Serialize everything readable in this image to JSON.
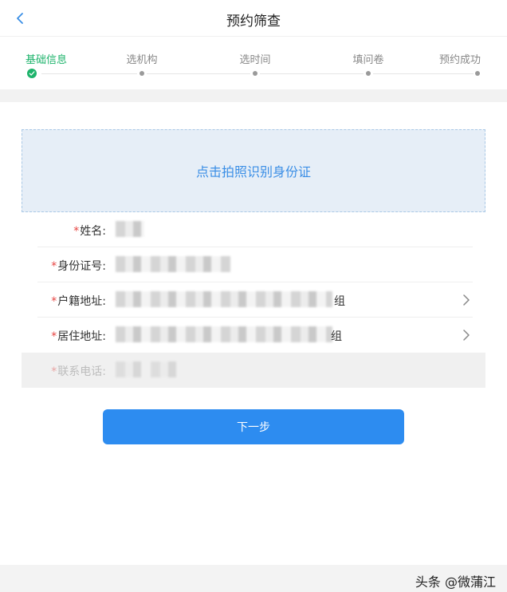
{
  "header": {
    "title": "预约筛查"
  },
  "steps": [
    {
      "label": "基础信息",
      "active": true
    },
    {
      "label": "选机构",
      "active": false
    },
    {
      "label": "选时间",
      "active": false
    },
    {
      "label": "填问卷",
      "active": false
    },
    {
      "label": "预约成功",
      "active": false
    }
  ],
  "photo": {
    "label": "点击拍照识别身份证"
  },
  "form": {
    "name_label": "姓名:",
    "idcard_label": "身份证号:",
    "hukou_label": "户籍地址:",
    "hukou_value_tail": "组",
    "residence_label": "居住地址:",
    "residence_value_tail": "组",
    "phone_label": "联系电话:"
  },
  "next_button": "下一步",
  "watermark": "头条 @微蒲江",
  "colors": {
    "accent": "#2d8cf0",
    "step_active": "#1db36b",
    "required": "#e64340"
  }
}
